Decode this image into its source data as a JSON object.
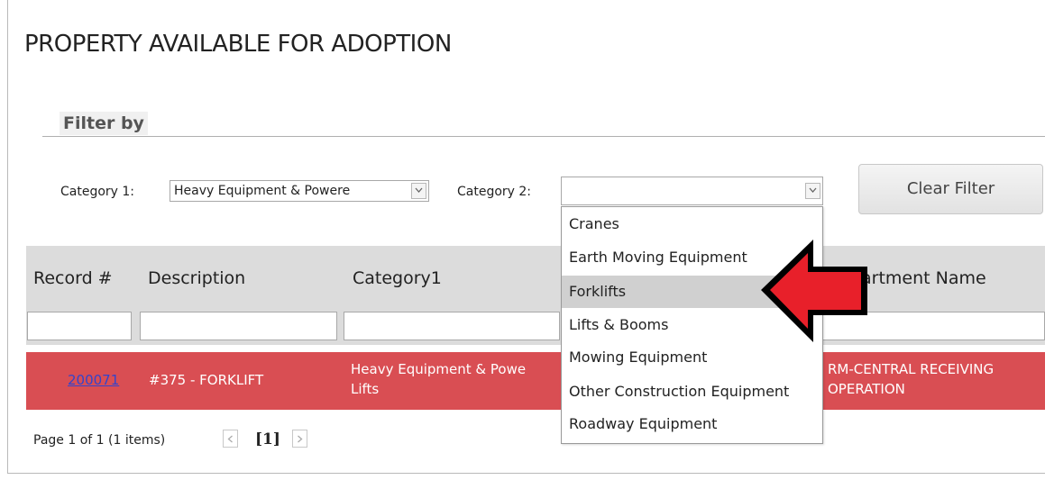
{
  "page": {
    "title": "PROPERTY AVAILABLE FOR ADOPTION"
  },
  "filter": {
    "heading": "Filter by",
    "category1_label": "Category 1:",
    "category1_value": "Heavy Equipment & Powere",
    "category2_label": "Category 2:",
    "category2_value": "",
    "clear_label": "Clear Filter"
  },
  "dropdown": {
    "options": [
      "Cranes",
      "Earth Moving Equipment",
      "Forklifts",
      "Lifts & Booms",
      "Mowing Equipment",
      "Other Construction Equipment",
      "Roadway Equipment"
    ],
    "highlighted": "Forklifts"
  },
  "table": {
    "columns": [
      "Record #",
      "Description",
      "Category1",
      "artment Name"
    ],
    "rows": [
      {
        "record": "200071",
        "description": "#375 - FORKLIFT",
        "category1_line1": "Heavy Equipment & Powe",
        "category1_line2": "Lifts",
        "department_line1": "RM-CENTRAL RECEIVING",
        "department_line2": "OPERATION"
      }
    ]
  },
  "pager": {
    "summary": "Page 1 of 1 (1 items)",
    "current": "[1]"
  },
  "colors": {
    "row_highlight": "#d94e53",
    "annotation_arrow": "#e8202a",
    "header_bg": "#dcdcdc"
  },
  "icons": [
    "chevron-down-icon",
    "chevron-left-icon",
    "chevron-right-icon",
    "red-arrow-annotation"
  ]
}
